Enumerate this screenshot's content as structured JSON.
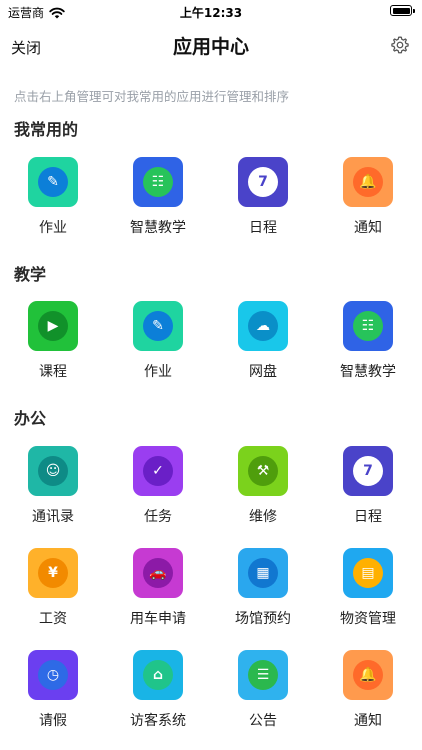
{
  "status_bar": {
    "carrier": "运营商",
    "time": "上午12:33"
  },
  "nav": {
    "close": "关闭",
    "title": "应用中心"
  },
  "hint": "点击右上角管理可对我常用的应用进行管理和排序",
  "sections": {
    "favorites": {
      "title": "我常用的",
      "apps": [
        {
          "label": "作业",
          "tile": "#1fd4a0",
          "inner": "#0c7fd8",
          "glyph": "✎"
        },
        {
          "label": "智慧教学",
          "tile": "#2f63e6",
          "inner": "#27c35a",
          "glyph": "☷"
        },
        {
          "label": "日程",
          "tile": "#4a43c9",
          "inner": "#ffffff",
          "glyph": "7"
        },
        {
          "label": "通知",
          "tile": "#ff9a4d",
          "inner": "#ff6a2a",
          "glyph": "🔔"
        }
      ]
    },
    "teaching": {
      "title": "教学",
      "apps": [
        {
          "label": "课程",
          "tile": "#21c13a",
          "inner": "#11912a",
          "glyph": "▶"
        },
        {
          "label": "作业",
          "tile": "#1fd4a0",
          "inner": "#0c7fd8",
          "glyph": "✎"
        },
        {
          "label": "网盘",
          "tile": "#19c7ea",
          "inner": "#0a8fc8",
          "glyph": "☁"
        },
        {
          "label": "智慧教学",
          "tile": "#2f63e6",
          "inner": "#27c35a",
          "glyph": "☷"
        }
      ]
    },
    "office": {
      "title": "办公",
      "apps": [
        {
          "label": "通讯录",
          "tile": "#1fb7a6",
          "inner": "#0e8b86",
          "glyph": "☺"
        },
        {
          "label": "任务",
          "tile": "#9a3ef0",
          "inner": "#6a1fc7",
          "glyph": "✓"
        },
        {
          "label": "维修",
          "tile": "#7bd21c",
          "inner": "#4f9e0c",
          "glyph": "⚒"
        },
        {
          "label": "日程",
          "tile": "#4a43c9",
          "inner": "#ffffff",
          "glyph": "7"
        },
        {
          "label": "工资",
          "tile": "#ffb12a",
          "inner": "#f28a00",
          "glyph": "¥"
        },
        {
          "label": "用车申请",
          "tile": "#c63ad2",
          "inner": "#8c1aa7",
          "glyph": "🚗"
        },
        {
          "label": "场馆预约",
          "tile": "#2aa7ee",
          "inner": "#1177d0",
          "glyph": "▦"
        },
        {
          "label": "物资管理",
          "tile": "#1fa8f0",
          "inner": "#ffb000",
          "glyph": "▤"
        },
        {
          "label": "请假",
          "tile": "#6b3ff0",
          "inner": "#2e6ae6",
          "glyph": "◷"
        },
        {
          "label": "访客系统",
          "tile": "#19b4e6",
          "inner": "#20c48a",
          "glyph": "⌂"
        },
        {
          "label": "公告",
          "tile": "#2fb2ee",
          "inner": "#2bb84e",
          "glyph": "☰"
        },
        {
          "label": "通知",
          "tile": "#ff9a4d",
          "inner": "#ff6a2a",
          "glyph": "🔔"
        }
      ]
    }
  }
}
